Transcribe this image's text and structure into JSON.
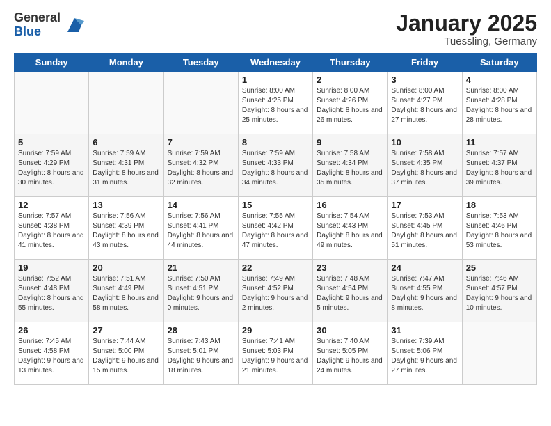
{
  "logo": {
    "general": "General",
    "blue": "Blue"
  },
  "header": {
    "title": "January 2025",
    "subtitle": "Tuessling, Germany"
  },
  "days_of_week": [
    "Sunday",
    "Monday",
    "Tuesday",
    "Wednesday",
    "Thursday",
    "Friday",
    "Saturday"
  ],
  "weeks": [
    [
      {
        "day": "",
        "content": ""
      },
      {
        "day": "",
        "content": ""
      },
      {
        "day": "",
        "content": ""
      },
      {
        "day": "1",
        "content": "Sunrise: 8:00 AM\nSunset: 4:25 PM\nDaylight: 8 hours and 25 minutes."
      },
      {
        "day": "2",
        "content": "Sunrise: 8:00 AM\nSunset: 4:26 PM\nDaylight: 8 hours and 26 minutes."
      },
      {
        "day": "3",
        "content": "Sunrise: 8:00 AM\nSunset: 4:27 PM\nDaylight: 8 hours and 27 minutes."
      },
      {
        "day": "4",
        "content": "Sunrise: 8:00 AM\nSunset: 4:28 PM\nDaylight: 8 hours and 28 minutes."
      }
    ],
    [
      {
        "day": "5",
        "content": "Sunrise: 7:59 AM\nSunset: 4:29 PM\nDaylight: 8 hours and 30 minutes."
      },
      {
        "day": "6",
        "content": "Sunrise: 7:59 AM\nSunset: 4:31 PM\nDaylight: 8 hours and 31 minutes."
      },
      {
        "day": "7",
        "content": "Sunrise: 7:59 AM\nSunset: 4:32 PM\nDaylight: 8 hours and 32 minutes."
      },
      {
        "day": "8",
        "content": "Sunrise: 7:59 AM\nSunset: 4:33 PM\nDaylight: 8 hours and 34 minutes."
      },
      {
        "day": "9",
        "content": "Sunrise: 7:58 AM\nSunset: 4:34 PM\nDaylight: 8 hours and 35 minutes."
      },
      {
        "day": "10",
        "content": "Sunrise: 7:58 AM\nSunset: 4:35 PM\nDaylight: 8 hours and 37 minutes."
      },
      {
        "day": "11",
        "content": "Sunrise: 7:57 AM\nSunset: 4:37 PM\nDaylight: 8 hours and 39 minutes."
      }
    ],
    [
      {
        "day": "12",
        "content": "Sunrise: 7:57 AM\nSunset: 4:38 PM\nDaylight: 8 hours and 41 minutes."
      },
      {
        "day": "13",
        "content": "Sunrise: 7:56 AM\nSunset: 4:39 PM\nDaylight: 8 hours and 43 minutes."
      },
      {
        "day": "14",
        "content": "Sunrise: 7:56 AM\nSunset: 4:41 PM\nDaylight: 8 hours and 44 minutes."
      },
      {
        "day": "15",
        "content": "Sunrise: 7:55 AM\nSunset: 4:42 PM\nDaylight: 8 hours and 47 minutes."
      },
      {
        "day": "16",
        "content": "Sunrise: 7:54 AM\nSunset: 4:43 PM\nDaylight: 8 hours and 49 minutes."
      },
      {
        "day": "17",
        "content": "Sunrise: 7:53 AM\nSunset: 4:45 PM\nDaylight: 8 hours and 51 minutes."
      },
      {
        "day": "18",
        "content": "Sunrise: 7:53 AM\nSunset: 4:46 PM\nDaylight: 8 hours and 53 minutes."
      }
    ],
    [
      {
        "day": "19",
        "content": "Sunrise: 7:52 AM\nSunset: 4:48 PM\nDaylight: 8 hours and 55 minutes."
      },
      {
        "day": "20",
        "content": "Sunrise: 7:51 AM\nSunset: 4:49 PM\nDaylight: 8 hours and 58 minutes."
      },
      {
        "day": "21",
        "content": "Sunrise: 7:50 AM\nSunset: 4:51 PM\nDaylight: 9 hours and 0 minutes."
      },
      {
        "day": "22",
        "content": "Sunrise: 7:49 AM\nSunset: 4:52 PM\nDaylight: 9 hours and 2 minutes."
      },
      {
        "day": "23",
        "content": "Sunrise: 7:48 AM\nSunset: 4:54 PM\nDaylight: 9 hours and 5 minutes."
      },
      {
        "day": "24",
        "content": "Sunrise: 7:47 AM\nSunset: 4:55 PM\nDaylight: 9 hours and 8 minutes."
      },
      {
        "day": "25",
        "content": "Sunrise: 7:46 AM\nSunset: 4:57 PM\nDaylight: 9 hours and 10 minutes."
      }
    ],
    [
      {
        "day": "26",
        "content": "Sunrise: 7:45 AM\nSunset: 4:58 PM\nDaylight: 9 hours and 13 minutes."
      },
      {
        "day": "27",
        "content": "Sunrise: 7:44 AM\nSunset: 5:00 PM\nDaylight: 9 hours and 15 minutes."
      },
      {
        "day": "28",
        "content": "Sunrise: 7:43 AM\nSunset: 5:01 PM\nDaylight: 9 hours and 18 minutes."
      },
      {
        "day": "29",
        "content": "Sunrise: 7:41 AM\nSunset: 5:03 PM\nDaylight: 9 hours and 21 minutes."
      },
      {
        "day": "30",
        "content": "Sunrise: 7:40 AM\nSunset: 5:05 PM\nDaylight: 9 hours and 24 minutes."
      },
      {
        "day": "31",
        "content": "Sunrise: 7:39 AM\nSunset: 5:06 PM\nDaylight: 9 hours and 27 minutes."
      },
      {
        "day": "",
        "content": ""
      }
    ]
  ]
}
